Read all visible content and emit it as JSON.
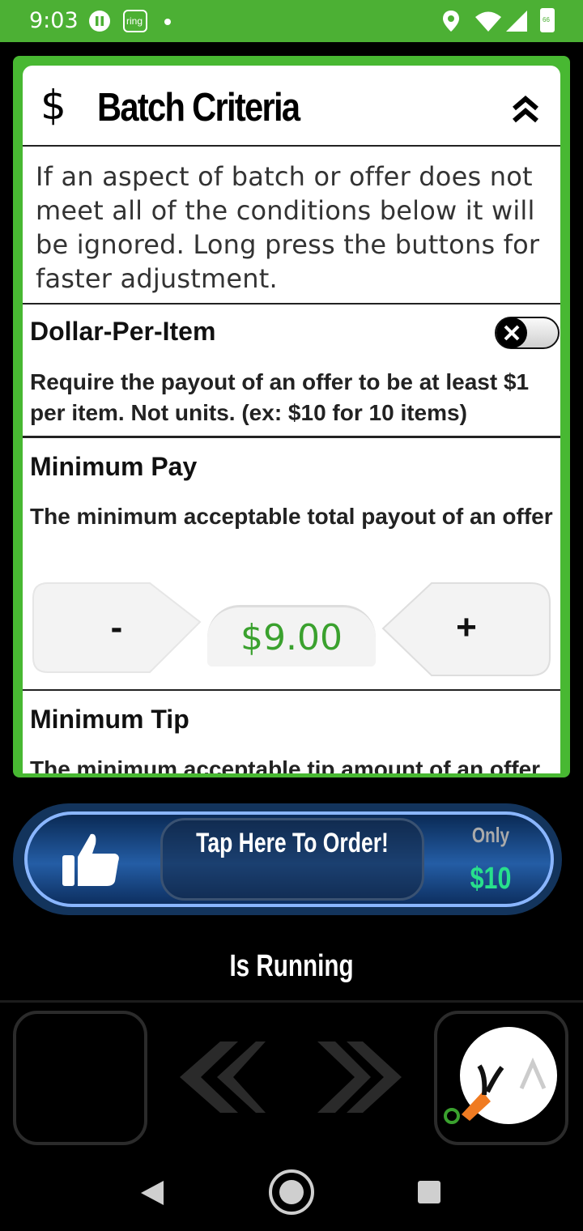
{
  "status_bar": {
    "time": "9:03",
    "ring_label": "ring",
    "battery_label": "66",
    "icons": [
      "pause-icon",
      "ring-app-icon",
      "notification-dot",
      "location-icon",
      "wifi-icon",
      "signal-icon",
      "battery-icon"
    ]
  },
  "card": {
    "title": "Batch Criteria",
    "currency_symbol": "$",
    "intro": "If an aspect of batch or offer does not meet all of the conditions below it will be ignored. Long press the buttons for faster adjustment."
  },
  "dollar_per_item": {
    "title": "Dollar-Per-Item",
    "desc": "Require the payout of an offer to be at least $1 per item. Not units. (ex: $10 for 10 items)",
    "enabled": false
  },
  "minimum_pay": {
    "title": "Minimum Pay",
    "desc": "The minimum acceptable total payout of an offer",
    "minus_label": "-",
    "plus_label": "+",
    "value": "$9.00"
  },
  "minimum_tip": {
    "title": "Minimum Tip",
    "desc": "The minimum acceptable tip amount of an offer"
  },
  "order_banner": {
    "cta": "Tap Here To Order!",
    "only_label": "Only",
    "price": "$10"
  },
  "running_label": "Is Running",
  "colors": {
    "status_green": "#4cb034",
    "accent_green": "#3aa12e",
    "banner_blue": "#245da5",
    "price_green": "#28e08c"
  }
}
